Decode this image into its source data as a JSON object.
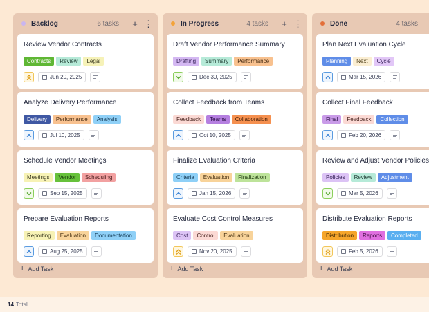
{
  "columns": [
    {
      "title": "Backlog",
      "count": "6 tasks",
      "dot": "#c9b5f0",
      "add_label": "Add Task",
      "cards": [
        {
          "title": "Review Vendor Contracts",
          "tags": [
            {
              "label": "Contracts",
              "bg": "#5fb734",
              "fg": "#ffffff"
            },
            {
              "label": "Review",
              "bg": "#b6ead8",
              "fg": "#1f3d33"
            },
            {
              "label": "Legal",
              "bg": "#f6f2b8",
              "fg": "#3b3a20"
            }
          ],
          "priority": "high",
          "date": "Jun 20, 2025"
        },
        {
          "title": "Analyze Delivery Performance",
          "tags": [
            {
              "label": "Delivery",
              "bg": "#3f58a3",
              "fg": "#ffffff"
            },
            {
              "label": "Performance",
              "bg": "#f8c18f",
              "fg": "#4a2e14"
            },
            {
              "label": "Analysis",
              "bg": "#8fd0f7",
              "fg": "#133a55"
            }
          ],
          "priority": "medium",
          "date": "Jul 10, 2025"
        },
        {
          "title": "Schedule Vendor Meetings",
          "tags": [
            {
              "label": "Meetings",
              "bg": "#f7f2b5",
              "fg": "#3b3a20"
            },
            {
              "label": "Vendor",
              "bg": "#67c13b",
              "fg": "#173a0b"
            },
            {
              "label": "Scheduling",
              "bg": "#f2a1a1",
              "fg": "#4a1d1d"
            }
          ],
          "priority": "low",
          "date": "Sep 15, 2025"
        },
        {
          "title": "Prepare Evaluation Reports",
          "tags": [
            {
              "label": "Reporting",
              "bg": "#f7f2b5",
              "fg": "#3b3a20"
            },
            {
              "label": "Evaluation",
              "bg": "#f8d39a",
              "fg": "#4a3314"
            },
            {
              "label": "Documentation",
              "bg": "#8fd0f7",
              "fg": "#133a55"
            }
          ],
          "priority": "medium",
          "date": "Aug 25, 2025"
        }
      ]
    },
    {
      "title": "In Progress",
      "count": "4 tasks",
      "dot": "#f3a33a",
      "add_label": "Add Task",
      "cards": [
        {
          "title": "Draft Vendor Performance Summary",
          "tags": [
            {
              "label": "Drafting",
              "bg": "#d4b8f2",
              "fg": "#38235a"
            },
            {
              "label": "Summary",
              "bg": "#b6ead8",
              "fg": "#1f3d33"
            },
            {
              "label": "Performance",
              "bg": "#f8c18f",
              "fg": "#4a2e14"
            }
          ],
          "priority": "low",
          "date": "Dec 30, 2025"
        },
        {
          "title": "Collect Feedback from Teams",
          "tags": [
            {
              "label": "Feedback",
              "bg": "#fbd9d4",
              "fg": "#4a2622"
            },
            {
              "label": "Teams",
              "bg": "#b57fe0",
              "fg": "#2a0f45"
            },
            {
              "label": "Collaboration",
              "bg": "#f5904f",
              "fg": "#3f1b05"
            }
          ],
          "priority": "medium",
          "date": "Oct 10, 2025"
        },
        {
          "title": "Finalize Evaluation Criteria",
          "tags": [
            {
              "label": "Criteria",
              "bg": "#8fd0f7",
              "fg": "#133a55"
            },
            {
              "label": "Evaluation",
              "bg": "#f8d39a",
              "fg": "#4a3314"
            },
            {
              "label": "Finalization",
              "bg": "#bde39a",
              "fg": "#233d12"
            }
          ],
          "priority": "medium",
          "date": "Jan 15, 2026"
        },
        {
          "title": "Evaluate Cost Control Measures",
          "tags": [
            {
              "label": "Cost",
              "bg": "#dcc3f5",
              "fg": "#38235a"
            },
            {
              "label": "Control",
              "bg": "#fbd9d4",
              "fg": "#4a2622"
            },
            {
              "label": "Evaluation",
              "bg": "#f8d39a",
              "fg": "#4a3314"
            }
          ],
          "priority": "high",
          "date": "Nov 20, 2025"
        }
      ]
    },
    {
      "title": "Done",
      "count": "4 tasks",
      "dot": "#e36f3a",
      "add_label": "Add Task",
      "cards": [
        {
          "title": "Plan Next Evaluation Cycle",
          "tags": [
            {
              "label": "Planning",
              "bg": "#5f8de8",
              "fg": "#ffffff"
            },
            {
              "label": "Next",
              "bg": "#fbeed2",
              "fg": "#4a3a14"
            },
            {
              "label": "Cycle",
              "bg": "#e2c7f7",
              "fg": "#38235a"
            }
          ],
          "priority": "medium",
          "date": "Mar 15, 2026"
        },
        {
          "title": "Collect Final Feedback",
          "tags": [
            {
              "label": "Final",
              "bg": "#c99be8",
              "fg": "#2a0f45"
            },
            {
              "label": "Feedback",
              "bg": "#fbd9d4",
              "fg": "#4a2622"
            },
            {
              "label": "Collection",
              "bg": "#5f8de8",
              "fg": "#ffffff"
            }
          ],
          "priority": "medium",
          "date": "Feb 20, 2026"
        },
        {
          "title": "Review and Adjust Vendor Policies",
          "tags": [
            {
              "label": "Policies",
              "bg": "#dcc3f5",
              "fg": "#38235a"
            },
            {
              "label": "Review",
              "bg": "#b6ead8",
              "fg": "#1f3d33"
            },
            {
              "label": "Adjustment",
              "bg": "#5f8de8",
              "fg": "#ffffff"
            }
          ],
          "priority": "low",
          "date": "Mar 5, 2026"
        },
        {
          "title": "Distribute Evaluation Reports",
          "tags": [
            {
              "label": "Distribution",
              "bg": "#f5a52a",
              "fg": "#3f2705"
            },
            {
              "label": "Reports",
              "bg": "#e06fe0",
              "fg": "#3a0a3a"
            },
            {
              "label": "Completed",
              "bg": "#5aaff0",
              "fg": "#ffffff"
            }
          ],
          "priority": "high",
          "date": "Feb 5, 2026"
        }
      ]
    }
  ],
  "footer": {
    "total_count": "14",
    "total_label": "Total"
  },
  "icons": {
    "add_icon": "+",
    "more_icon": "⋮",
    "calendar": "calendar-icon",
    "description": "description-icon"
  },
  "priority_styles": {
    "high": {
      "border": "#f2c65a",
      "bg": "#fff7e0",
      "color": "#e0a019",
      "glyph": "double-chevron-up"
    },
    "medium": {
      "border": "#5a9be0",
      "bg": "#eef5fd",
      "color": "#2f7bd1",
      "glyph": "chevron-up"
    },
    "low": {
      "border": "#8ccf5c",
      "bg": "#f1fae9",
      "color": "#4ea324",
      "glyph": "chevron-down"
    }
  }
}
